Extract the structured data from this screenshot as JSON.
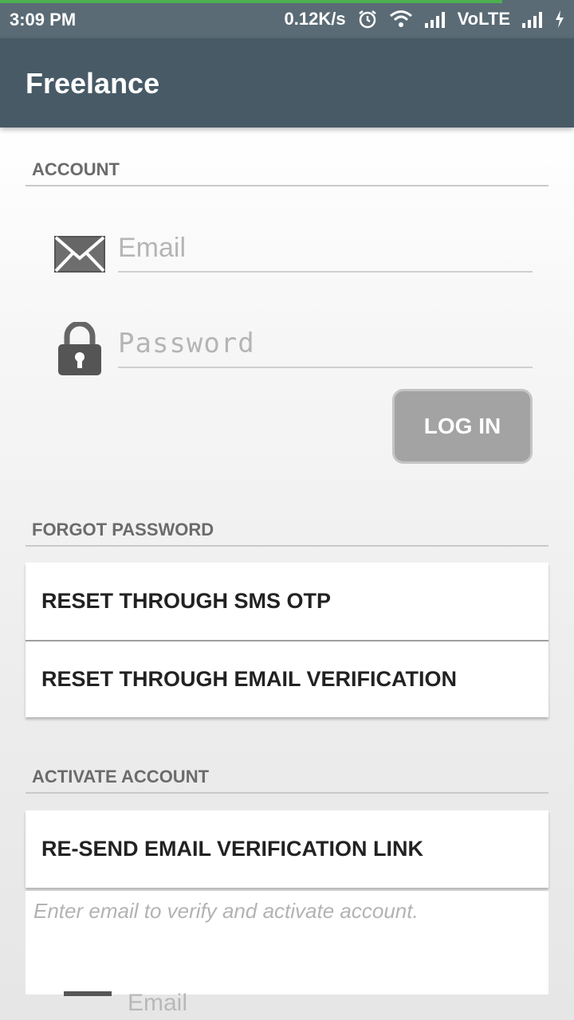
{
  "status_bar": {
    "time": "3:09 PM",
    "speed": "0.12K/s",
    "network": "VoLTE",
    "icons": [
      "alarm-icon",
      "wifi-icon",
      "signal-icon",
      "signal-icon",
      "charging-icon"
    ]
  },
  "app_bar": {
    "title": "Freelance"
  },
  "account": {
    "header": "ACCOUNT",
    "email_placeholder": "Email",
    "password_placeholder": "Password",
    "login_label": "LOG IN"
  },
  "forgot_password": {
    "header": "FORGOT PASSWORD",
    "items": [
      "RESET THROUGH SMS OTP",
      "RESET THROUGH EMAIL VERIFICATION"
    ]
  },
  "activate_account": {
    "header": "ACTIVATE ACCOUNT",
    "resend_label": "RE-SEND EMAIL VERIFICATION LINK",
    "hint": "Enter email to verify and activate account.",
    "email_partial": "Email"
  },
  "colors": {
    "app_bar": "#475a66",
    "status_bar": "#5a6b75",
    "button_disabled": "#a3a3a3",
    "progress": "#4caf50"
  }
}
